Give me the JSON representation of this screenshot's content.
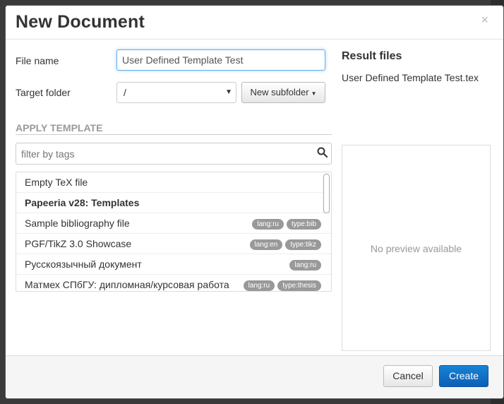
{
  "dialog": {
    "title": "New Document",
    "close_glyph": "×"
  },
  "form": {
    "file_name_label": "File name",
    "file_name_value": "User Defined Template Test",
    "target_folder_label": "Target folder",
    "target_folder_value": "/",
    "new_subfolder_label": "New subfolder"
  },
  "template": {
    "section_title": "APPLY TEMPLATE",
    "filter_placeholder": "filter by tags",
    "items": [
      {
        "label": "Empty TeX file",
        "tags": []
      },
      {
        "label": "Papeeria v28: Templates",
        "group": true,
        "tags": []
      },
      {
        "label": "Sample bibliography file",
        "tags": [
          "lang:ru",
          "type:bib"
        ]
      },
      {
        "label": "PGF/TikZ 3.0 Showcase",
        "tags": [
          "lang:en",
          "type:tikz"
        ]
      },
      {
        "label": "Русскоязычный документ",
        "tags": [
          "lang:ru"
        ]
      },
      {
        "label": "Матмех СПбГУ: дипломная/курсовая работа",
        "tags": [
          "lang:ru",
          "type:thesis"
        ]
      }
    ]
  },
  "result": {
    "title": "Result files",
    "file": "User Defined Template Test.tex",
    "preview_text": "No preview available"
  },
  "footer": {
    "cancel_label": "Cancel",
    "create_label": "Create"
  },
  "colors": {
    "primary": "#0f6fc6",
    "tag": "#999999"
  }
}
